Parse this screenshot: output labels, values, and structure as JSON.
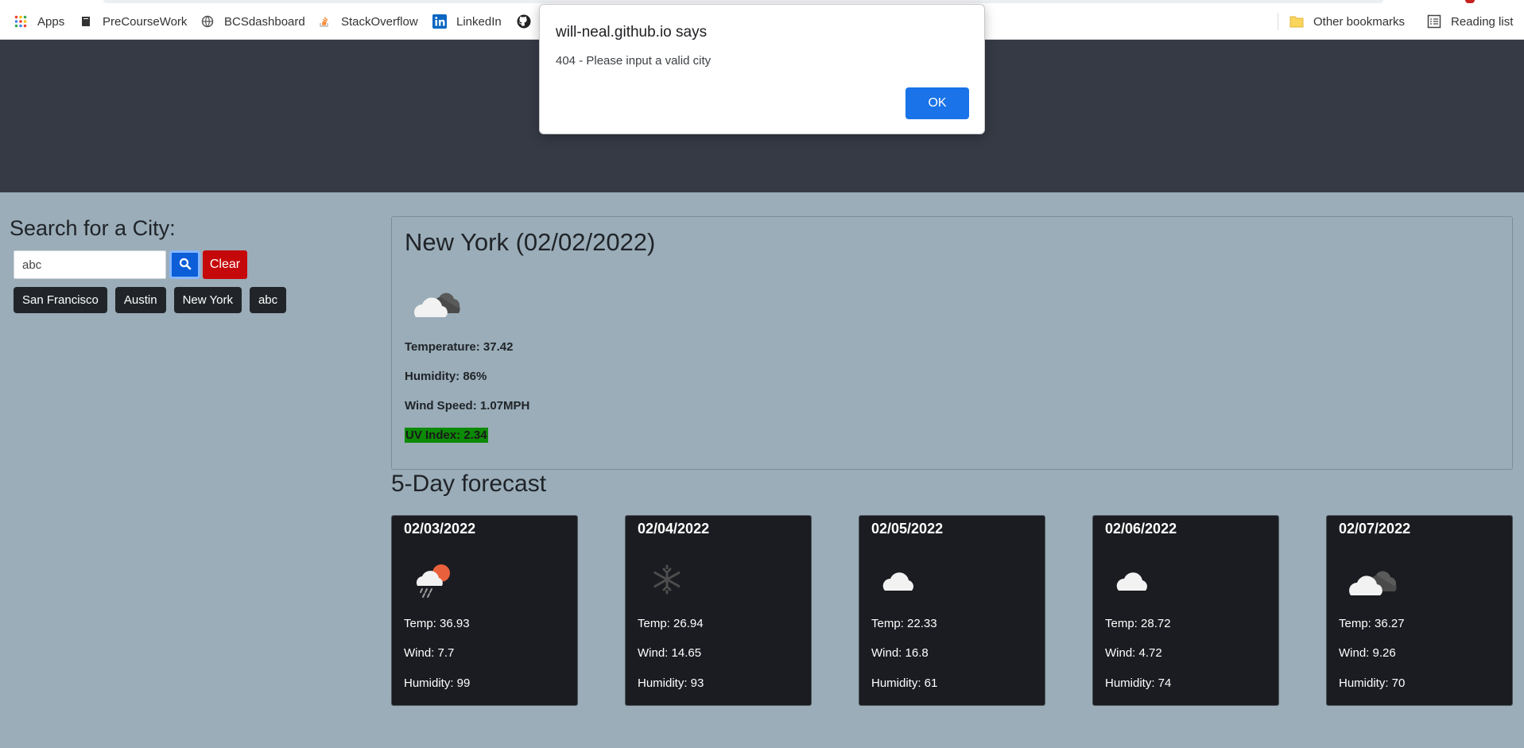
{
  "bookmarks": {
    "items": [
      {
        "label": "Apps",
        "icon": "apps-grid-icon"
      },
      {
        "label": "PreCourseWork",
        "icon": "book-icon"
      },
      {
        "label": "BCSdashboard",
        "icon": "globe-icon"
      },
      {
        "label": "StackOverflow",
        "icon": "stackoverflow-icon"
      },
      {
        "label": "LinkedIn",
        "icon": "linkedin-icon"
      },
      {
        "label": "",
        "icon": "github-icon"
      }
    ],
    "other_bookmarks": "Other bookmarks",
    "reading_list": "Reading list"
  },
  "sidebar": {
    "title": "Search for a City:",
    "search_value": "abc",
    "clear_label": "Clear",
    "history": [
      "San Francisco",
      "Austin",
      "New York",
      "abc"
    ]
  },
  "current": {
    "title": "New York (02/02/2022)",
    "icon": "cloudy-icon",
    "temperature": "Temperature: 37.42",
    "humidity": "Humidity: 86%",
    "wind": "Wind Speed: 1.07MPH",
    "uv": "UV Index: 2.34",
    "uv_color": "#0c8a06"
  },
  "forecast": {
    "title": "5-Day forecast",
    "days": [
      {
        "date": "02/03/2022",
        "icon": "rain-sun-icon",
        "temp": "Temp: 36.93",
        "wind": "Wind: 7.7",
        "humidity": "Humidity: 99"
      },
      {
        "date": "02/04/2022",
        "icon": "snowflake-icon",
        "temp": "Temp: 26.94",
        "wind": "Wind: 14.65",
        "humidity": "Humidity: 93"
      },
      {
        "date": "02/05/2022",
        "icon": "cloud-icon",
        "temp": "Temp: 22.33",
        "wind": "Wind: 16.8",
        "humidity": "Humidity: 61"
      },
      {
        "date": "02/06/2022",
        "icon": "cloud-icon",
        "temp": "Temp: 28.72",
        "wind": "Wind: 4.72",
        "humidity": "Humidity: 74"
      },
      {
        "date": "02/07/2022",
        "icon": "cloudy-icon",
        "temp": "Temp: 36.27",
        "wind": "Wind: 9.26",
        "humidity": "Humidity: 70"
      }
    ]
  },
  "dialog": {
    "title": "will-neal.github.io says",
    "message": "404 - Please input a valid city",
    "ok_label": "OK",
    "ok_color": "#1a73e8"
  },
  "colors": {
    "page_bg": "#9aadb8",
    "header_bg": "#353a45",
    "card_bg": "#1a1c21",
    "search_button": "#0b5ed7",
    "clear_button": "#c5090b"
  }
}
